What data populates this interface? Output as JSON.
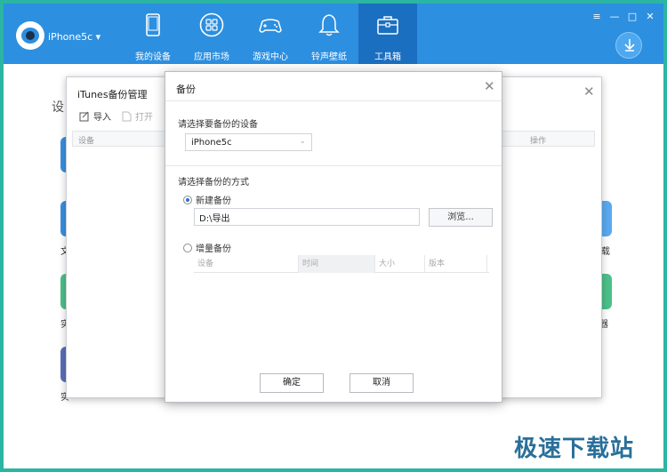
{
  "header": {
    "device_name": "iPhone5c ▾",
    "nav": [
      {
        "label": "我的设备",
        "icon": "phone-icon"
      },
      {
        "label": "应用市场",
        "icon": "apps-grid-icon"
      },
      {
        "label": "游戏中心",
        "icon": "gamepad-icon"
      },
      {
        "label": "铃声壁纸",
        "icon": "bell-icon"
      },
      {
        "label": "工具箱",
        "icon": "toolbox-icon",
        "active": true
      }
    ],
    "window_controls": [
      "≡",
      "—",
      "□",
      "✕"
    ],
    "accent_color": "#2c8fe0",
    "active_color": "#1b6fc0"
  },
  "background": {
    "title": "设",
    "right_labels": [
      "载",
      "拟器"
    ],
    "left_labels": [
      "文",
      "实",
      "实"
    ]
  },
  "itunes_window": {
    "title": "iTunes备份管理",
    "close": "✕",
    "toolbar": {
      "import_label": "导入",
      "open_label": "打开"
    },
    "table_headers": {
      "device": "设备",
      "action": "操作"
    }
  },
  "backup_dialog": {
    "title": "备份",
    "close": "✕",
    "select_device_label": "请选择要备份的设备",
    "selected_device": "iPhone5c",
    "select_method_label": "请选择备份的方式",
    "new_backup_label": "新建备份",
    "path_value": "D:\\导出",
    "browse_label": "浏览...",
    "incremental_label": "增量备份",
    "incremental_columns": [
      "设备",
      "时间",
      "大小",
      "版本"
    ],
    "ok_label": "确定",
    "cancel_label": "取消"
  },
  "watermark": "极速下载站"
}
